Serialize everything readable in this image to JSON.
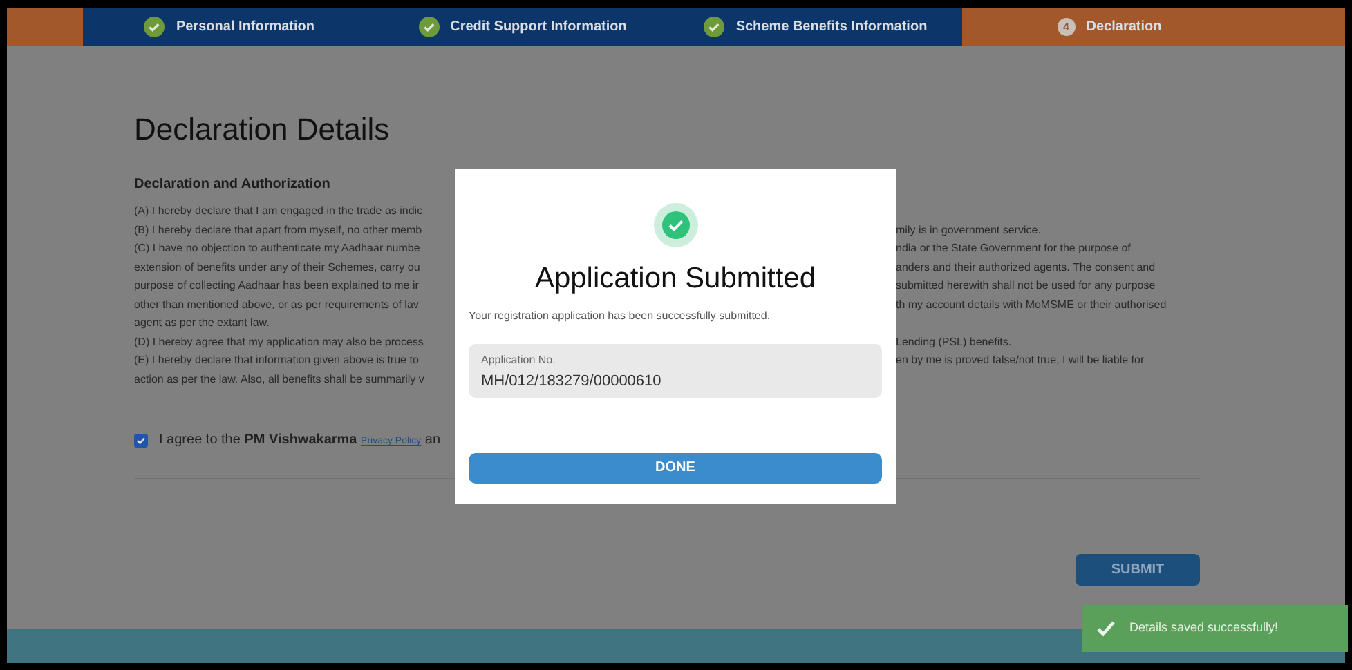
{
  "steps": [
    {
      "label": "Personal Information",
      "kind": "done",
      "selected": false
    },
    {
      "label": "Credit Support Information",
      "kind": "done",
      "selected": false
    },
    {
      "label": "Scheme Benefits Information",
      "kind": "done",
      "selected": false
    },
    {
      "label": "Declaration",
      "kind": "current",
      "number": "4",
      "selected": true
    }
  ],
  "page": {
    "title": "Declaration Details",
    "section_title": "Declaration and Authorization",
    "lines": [
      {
        "left": "(A) I hereby declare that I am engaged in the trade as indic"
      },
      {
        "left": "(B) I hereby declare that apart from myself, no other memb",
        "right": "mily is in government service."
      },
      {
        "left": "(C) I have no objection to authenticate my Aadhaar numbe",
        "right": "ndia or the State Government for the purpose of"
      },
      {
        "left": "extension of benefits under any of their Schemes, carry ou",
        "right": "anders and their authorized agents. The consent and"
      },
      {
        "left": "purpose of collecting Aadhaar has been explained to me ir",
        "right": "submitted herewith shall not be used for any purpose"
      },
      {
        "left": "other than mentioned above, or as per requirements of lav",
        "right": "th my account details with MoMSME or their authorised"
      },
      {
        "left": "agent as per the extant law."
      },
      {
        "left": "(D) I hereby agree that my application may also be process",
        "right": "Lending (PSL) benefits."
      },
      {
        "left": "(E) I hereby declare that information given above is true to",
        "right": "en by me is proved false/not true, I will be liable for"
      },
      {
        "left": "action as per the law. Also, all benefits shall be summarily v"
      }
    ],
    "agreement": {
      "checked": true,
      "before": "I agree to the **PM Vishwakarma**",
      "link": "Privacy Policy",
      "after": "an"
    },
    "submit_button": "SUBMIT"
  },
  "dialog": {
    "title": "Application Submitted",
    "message": "Your registration application has been successfully submitted.",
    "field_label": "Application No.",
    "field_value": "MH/012/183279/00000610",
    "button": "DONE"
  },
  "toast": {
    "message": "Details saved successfully!"
  }
}
